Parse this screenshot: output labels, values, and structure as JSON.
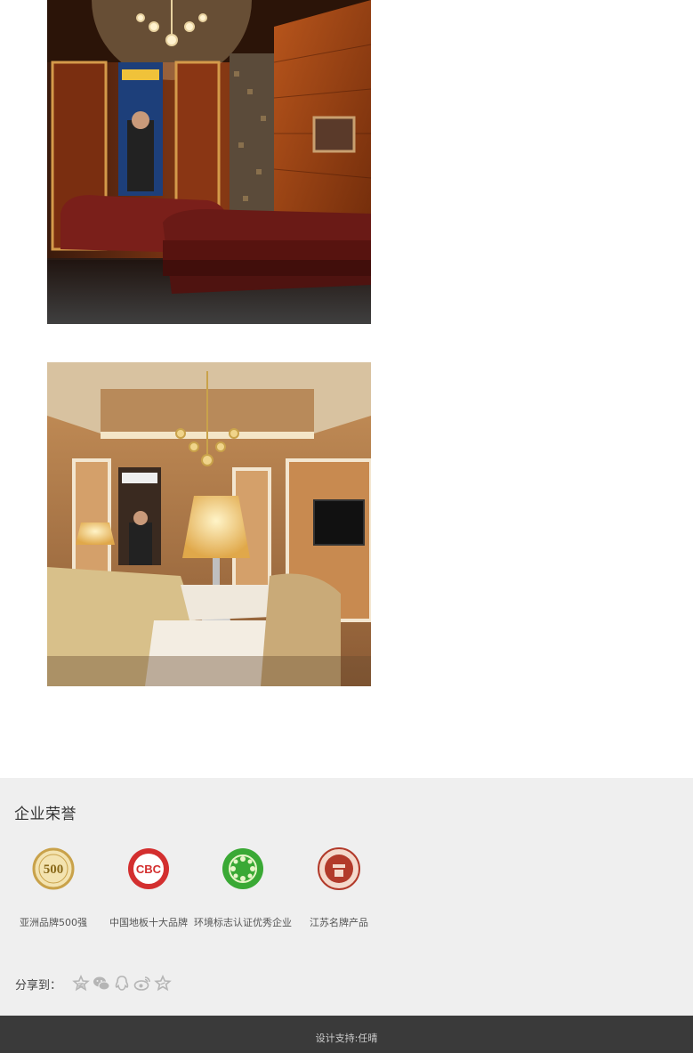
{
  "honors": {
    "title": "企业荣誉",
    "items": [
      {
        "label": "亚洲品牌500强",
        "icon": "asia-brand-500-badge-icon",
        "color": "#c9a24a",
        "logo_text": "500"
      },
      {
        "label": "中国地板十大品牌",
        "icon": "cbc-badge-icon",
        "color": "#d32f2f",
        "logo_text": "CBC"
      },
      {
        "label": "环境标志认证优秀企业",
        "icon": "environmental-label-badge-icon",
        "color": "#3aa935"
      },
      {
        "label": "江苏名牌产品",
        "icon": "jiangsu-famous-brand-badge-icon",
        "color": "#b23a2a"
      }
    ]
  },
  "share": {
    "label": "分享到：",
    "icons": [
      "qzone-icon",
      "wechat-icon",
      "qq-icon",
      "weibo-icon",
      "favorite-star-icon"
    ]
  },
  "footer": {
    "credit": "设计支持:任晴"
  },
  "colors": {
    "honors_bg": "#efefef",
    "footer_bg": "#3a3a3a",
    "share_icon": "#b5b5b5"
  }
}
